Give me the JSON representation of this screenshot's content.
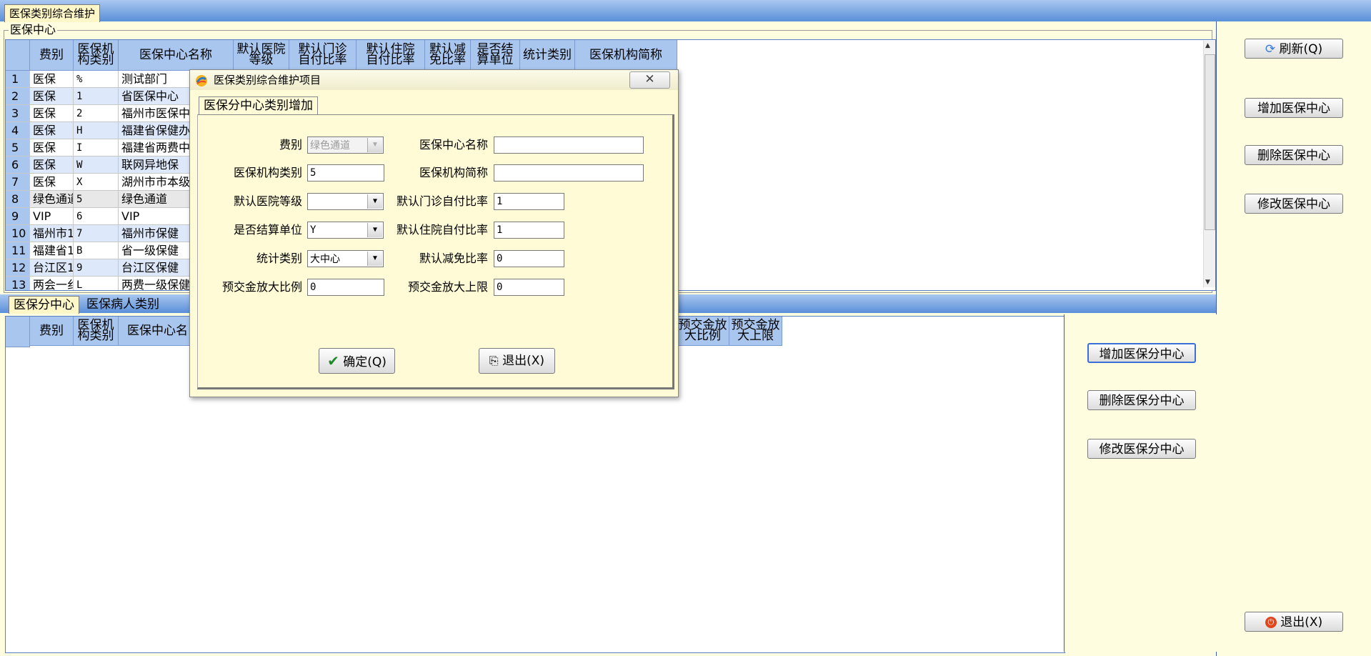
{
  "main_tab": "医保类别综合维护",
  "group_label": "医保中心",
  "upper_grid": {
    "headers": [
      "费别",
      "医保机\n构类别",
      "医保中心名称",
      "默认医院\n等级",
      "默认门诊\n自付比率",
      "默认住院\n自付比率",
      "默认减\n免比率",
      "是否结\n算单位",
      "统计类别",
      "医保机构简称"
    ],
    "rows": [
      {
        "num": "1",
        "fee": "医保",
        "cat": "%",
        "name": "测试部门"
      },
      {
        "num": "2",
        "fee": "医保",
        "cat": "1",
        "name": "省医保中心"
      },
      {
        "num": "3",
        "fee": "医保",
        "cat": "2",
        "name": "福州市医保中"
      },
      {
        "num": "4",
        "fee": "医保",
        "cat": "H",
        "name": "福建省保健办"
      },
      {
        "num": "5",
        "fee": "医保",
        "cat": "I",
        "name": "福建省两费中"
      },
      {
        "num": "6",
        "fee": "医保",
        "cat": "W",
        "name": "联网异地保"
      },
      {
        "num": "7",
        "fee": "医保",
        "cat": "X",
        "name": "湖州市市本级"
      },
      {
        "num": "8",
        "fee": "绿色通道",
        "cat": "5",
        "name": "绿色通道"
      },
      {
        "num": "9",
        "fee": "VIP",
        "cat": "6",
        "name": "VIP"
      },
      {
        "num": "10",
        "fee": "福州市1",
        "cat": "7",
        "name": "福州市保健"
      },
      {
        "num": "11",
        "fee": "福建省1",
        "cat": "B",
        "name": "省一级保健"
      },
      {
        "num": "12",
        "fee": "台江区1",
        "cat": "9",
        "name": "台江区保健"
      },
      {
        "num": "13",
        "fee": "两会一纟",
        "cat": "L",
        "name": "两费一级保健"
      }
    ]
  },
  "right_panel": {
    "refresh": "刷新(Q)",
    "add_center": "增加医保中心",
    "delete_center": "删除医保中心",
    "modify_center": "修改医保中心",
    "exit": "退出(X)"
  },
  "bottom_tabs": [
    "医保分中心",
    "医保病人类别"
  ],
  "lower_grid": {
    "headers": [
      "费别",
      "医保机\n构类别",
      "医保中心名",
      "预交金放\n大比例",
      "预交金放\n大上限"
    ]
  },
  "lower_panel": {
    "add_sub": "增加医保分中心",
    "delete_sub": "删除医保分中心",
    "modify_sub": "修改医保分中心"
  },
  "dialog": {
    "title": "医保类别综合维护项目",
    "close": "✕",
    "tab": "医保分中心类别增加",
    "fields": {
      "fee_label": "费别",
      "fee_value": "绿色通道",
      "center_name_label": "医保中心名称",
      "center_name_value": "",
      "org_cat_label": "医保机构类别",
      "org_cat_value": "5",
      "org_abbr_label": "医保机构简称",
      "org_abbr_value": "",
      "hosp_level_label": "默认医院等级",
      "hosp_level_value": "",
      "outpatient_label": "默认门诊自付比率",
      "outpatient_value": "1",
      "settle_label": "是否结算单位",
      "settle_value": "Y",
      "inpatient_label": "默认住院自付比率",
      "inpatient_value": "1",
      "stat_label": "统计类别",
      "stat_value": "大中心",
      "reduce_label": "默认减免比率",
      "reduce_value": "0",
      "prepay_ratio_label": "预交金放大比例",
      "prepay_ratio_value": "0",
      "prepay_limit_label": "预交金放大上限",
      "prepay_limit_value": "0"
    },
    "ok": "确定(Q)",
    "exit": "退出(X)"
  }
}
